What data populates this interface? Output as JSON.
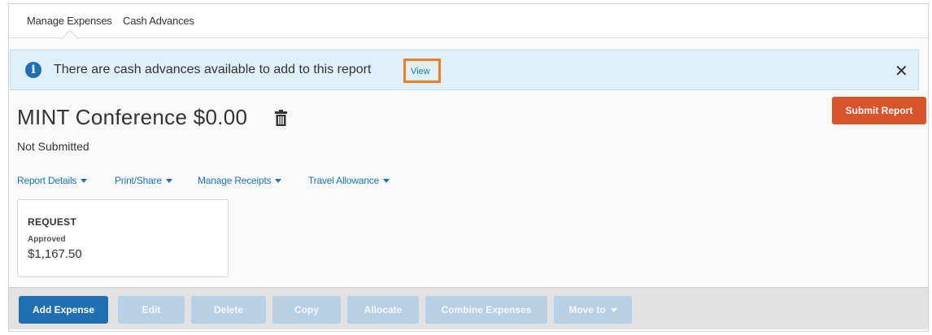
{
  "tabs": [
    {
      "label": "Manage Expenses",
      "active": true
    },
    {
      "label": "Cash Advances",
      "active": false
    }
  ],
  "banner": {
    "icon": "info-icon",
    "message": "There are cash advances available to add to this report",
    "link_label": "View",
    "highlight_color": "#f07e22",
    "close_icon": "close-icon"
  },
  "report": {
    "title": "MINT Conference $0.00",
    "status": "Not Submitted",
    "submit_label": "Submit Report",
    "submit_color": "#d9532b"
  },
  "menus": [
    {
      "label": "Report Details"
    },
    {
      "label": "Print/Share"
    },
    {
      "label": "Manage Receipts"
    },
    {
      "label": "Travel Allowance"
    }
  ],
  "request_card": {
    "heading": "REQUEST",
    "status": "Approved",
    "amount": "$1,167.50"
  },
  "toolbar": {
    "add_expense": "Add Expense",
    "edit": "Edit",
    "delete": "Delete",
    "copy": "Copy",
    "allocate": "Allocate",
    "combine_expenses": "Combine Expenses",
    "move_to": "Move to",
    "primary_color": "#1f6fb2"
  }
}
